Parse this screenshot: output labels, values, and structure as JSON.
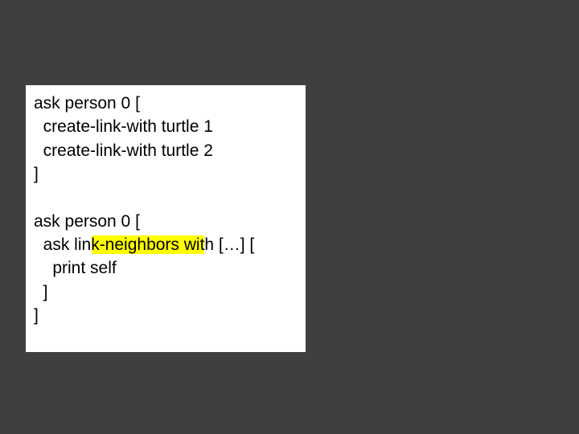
{
  "code": {
    "line1": "ask person 0 [",
    "line2": "  create-link-with turtle 1",
    "line3": "  create-link-with turtle 2",
    "line4": "]",
    "line5": "",
    "line6": "ask person 0 [",
    "line7": "  ask link-neighbors with […] [",
    "line8": "    print self",
    "line9": "  ]",
    "line10": "]"
  }
}
